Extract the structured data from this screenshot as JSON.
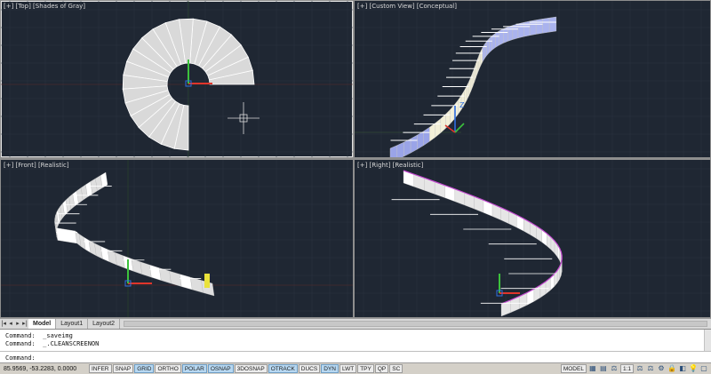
{
  "viewports": {
    "top": {
      "label": "[+] [Top] [Shades of Gray]",
      "active": true
    },
    "custom": {
      "label": "[+] [Custom View] [Conceptual]"
    },
    "front": {
      "label": "[+] [Front] [Realistic]"
    },
    "right": {
      "label": "[+] [Right] [Realistic]"
    }
  },
  "layout_tabs": {
    "nav": [
      "|◂",
      "◂",
      "▸",
      "▸|"
    ],
    "tabs": [
      "Model",
      "Layout1",
      "Layout2"
    ],
    "active": "Model"
  },
  "command_window": {
    "history": [
      "Command:  _saveimg",
      "Command:  _.CLEANSCREENON"
    ],
    "prompt": "Command:"
  },
  "statusbar": {
    "coordinates": "85.9569, -53.2283, 0.0000",
    "toggles": [
      {
        "label": "INFER",
        "on": false
      },
      {
        "label": "SNAP",
        "on": false
      },
      {
        "label": "GRID",
        "on": true
      },
      {
        "label": "ORTHO",
        "on": false
      },
      {
        "label": "POLAR",
        "on": true
      },
      {
        "label": "OSNAP",
        "on": true
      },
      {
        "label": "3DOSNAP",
        "on": false
      },
      {
        "label": "OTRACK",
        "on": true
      },
      {
        "label": "DUCS",
        "on": false
      },
      {
        "label": "DYN",
        "on": true
      },
      {
        "label": "LWT",
        "on": false
      },
      {
        "label": "TPY",
        "on": false
      },
      {
        "label": "QP",
        "on": false
      },
      {
        "label": "SC",
        "on": false
      }
    ],
    "model_label": "MODEL",
    "annotation_scale": "1:1",
    "icons": [
      "quick-view-layouts-icon",
      "quick-view-drawings-icon",
      "annotation-scale-icon",
      "annotation-visibility-icon",
      "auto-scale-icon",
      "workspace-switching-icon",
      "lock-icon",
      "hardware-acceleration-icon",
      "isolate-objects-icon",
      "clean-screen-icon"
    ]
  },
  "colors": {
    "viewport_bg": "#1f2733",
    "axis_x": "#e0352b",
    "axis_y": "#3cc23c",
    "axis_z": "#2f6fe0",
    "stair_light": "#e8e8e8",
    "stair_blue": "#9aa4e8",
    "stair_cream": "#f3f0d8",
    "handrail_magenta": "#c44bd1",
    "highlight_yellow": "#e9e23a"
  }
}
